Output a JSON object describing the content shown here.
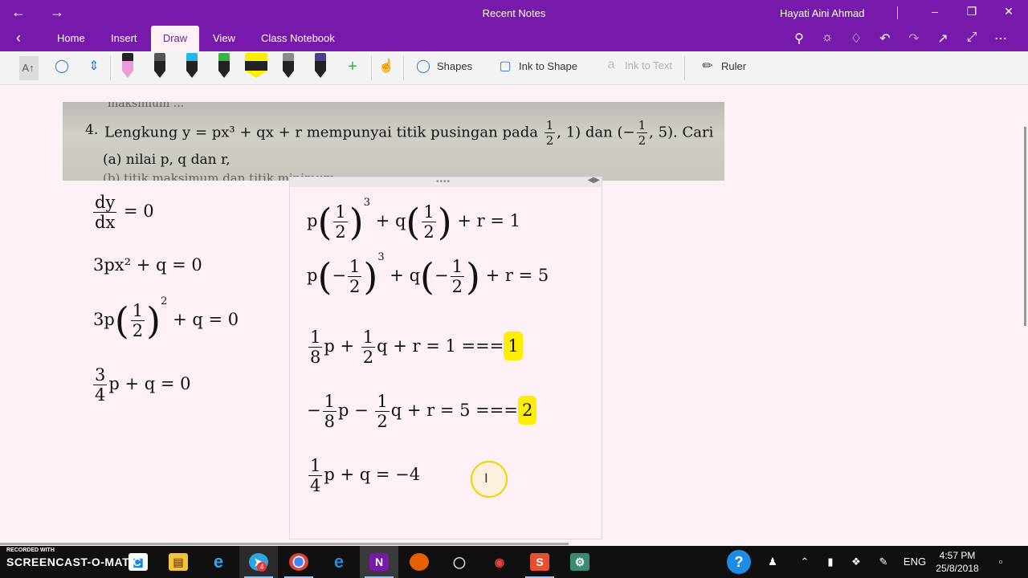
{
  "window": {
    "title": "Recent Notes",
    "user": "Hayati Aini Ahmad"
  },
  "ribbon": {
    "tabs": [
      "Home",
      "Insert",
      "Draw",
      "View",
      "Class Notebook"
    ],
    "active_tab": "Draw"
  },
  "toolbar": {
    "shapes": "Shapes",
    "ink_to_shape": "Ink to Shape",
    "ink_to_text": "Ink to Text",
    "ruler": "Ruler",
    "pens": [
      {
        "name": "pink-pen",
        "color": "#e89bd4"
      },
      {
        "name": "black-pen",
        "color": "#222222"
      },
      {
        "name": "cyan-pen",
        "color": "#25b6e9"
      },
      {
        "name": "green-pen",
        "color": "#3cb043"
      },
      {
        "name": "yellow-highlighter",
        "color": "#ffee00"
      },
      {
        "name": "gray-pen",
        "color": "#8a8a8a"
      },
      {
        "name": "purple-pen",
        "color": "#4b3f8a"
      }
    ]
  },
  "photo": {
    "number": "4.",
    "question_text": "Lengkung y = px³ + qx + r mempunyai titik pusingan pada",
    "point_conj": "dan",
    "cari": ". Cari",
    "part_a": "(a)   nilai p, q dan r,",
    "clip_top": "maksimum ...",
    "clip_bottom": "(b)   titik maksimum dan titik minimum"
  },
  "left_math": {
    "dy": "dy",
    "dx": "dx",
    "eq0": "= 0",
    "line2": "3px² + q = 0",
    "line3_pre": "3p",
    "line3_post": "+ q = 0",
    "line4_n": "3",
    "line4_d": "4",
    "line4_post": "p + q = 0"
  },
  "right_math": {
    "eq1_post": "+ r = 1",
    "eq2_post": "+ r = 5",
    "eq3_text": "p + ",
    "eq3_text2": "q + r = 1 ===",
    "tag1": "1",
    "eq4_text": "p − ",
    "eq4_text2": "q + r = 5 ===",
    "tag2": "2",
    "eq5_text": "p + q = −4"
  },
  "taskbar": {
    "watermark_top": "RECORDED WITH",
    "watermark_main": "SCREENCAST-O-MATIC",
    "badge": "4",
    "lang": "ENG",
    "time": "4:57 PM",
    "date": "25/8/2018"
  }
}
